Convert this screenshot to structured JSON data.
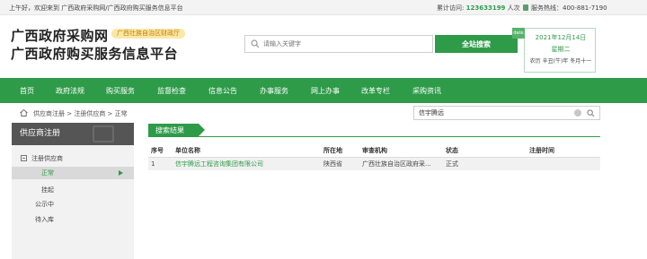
{
  "topbar": {
    "welcome": "上午好，欢迎来到 广西政府采购网/广西政府购买服务信息平台",
    "visits_label": "累计访问:",
    "visits_count": "123633199",
    "visits_unit": "人次",
    "hotline": "服务热线：400-881-7190"
  },
  "header": {
    "logo_line1": "广西政府采购网",
    "logo_line2": "广西政府购买服务信息平台",
    "dept_badge": "广西壮族自治区财政厅",
    "search_placeholder": "请输入关键字",
    "search_button": "全站搜索",
    "date_tag": "date",
    "date": "2021年12月14日",
    "weekday": "星期二",
    "lunar": "农历 辛丑(牛)年 冬月十一"
  },
  "nav": {
    "items": [
      "首页",
      "政府法规",
      "购买服务",
      "监督检查",
      "信息公告",
      "办事服务",
      "网上办事",
      "改革专栏",
      "采购资讯"
    ]
  },
  "breadcrumb": "供应商注册 > 注册供应商 > 正常",
  "right_search": {
    "value": "信宇腾远"
  },
  "sidebar": {
    "title": "供应商注册",
    "group": "注册供应商",
    "items": [
      "正常",
      "挂起",
      "公示中",
      "待入库"
    ],
    "active_index": 0
  },
  "results": {
    "tab": "搜索结果",
    "columns": [
      "序号",
      "单位名称",
      "所在地",
      "审查机构",
      "状态",
      "注册时间"
    ],
    "rows": [
      [
        "1",
        "信宇腾远工程咨询集团有限公司",
        "陕西省",
        "广西壮族自治区政府采...",
        "正式",
        ""
      ]
    ]
  },
  "colors": {
    "brand_green": "#2e9b49",
    "sidebar_head": "#555555",
    "badge_bg": "#fbe8a6"
  }
}
